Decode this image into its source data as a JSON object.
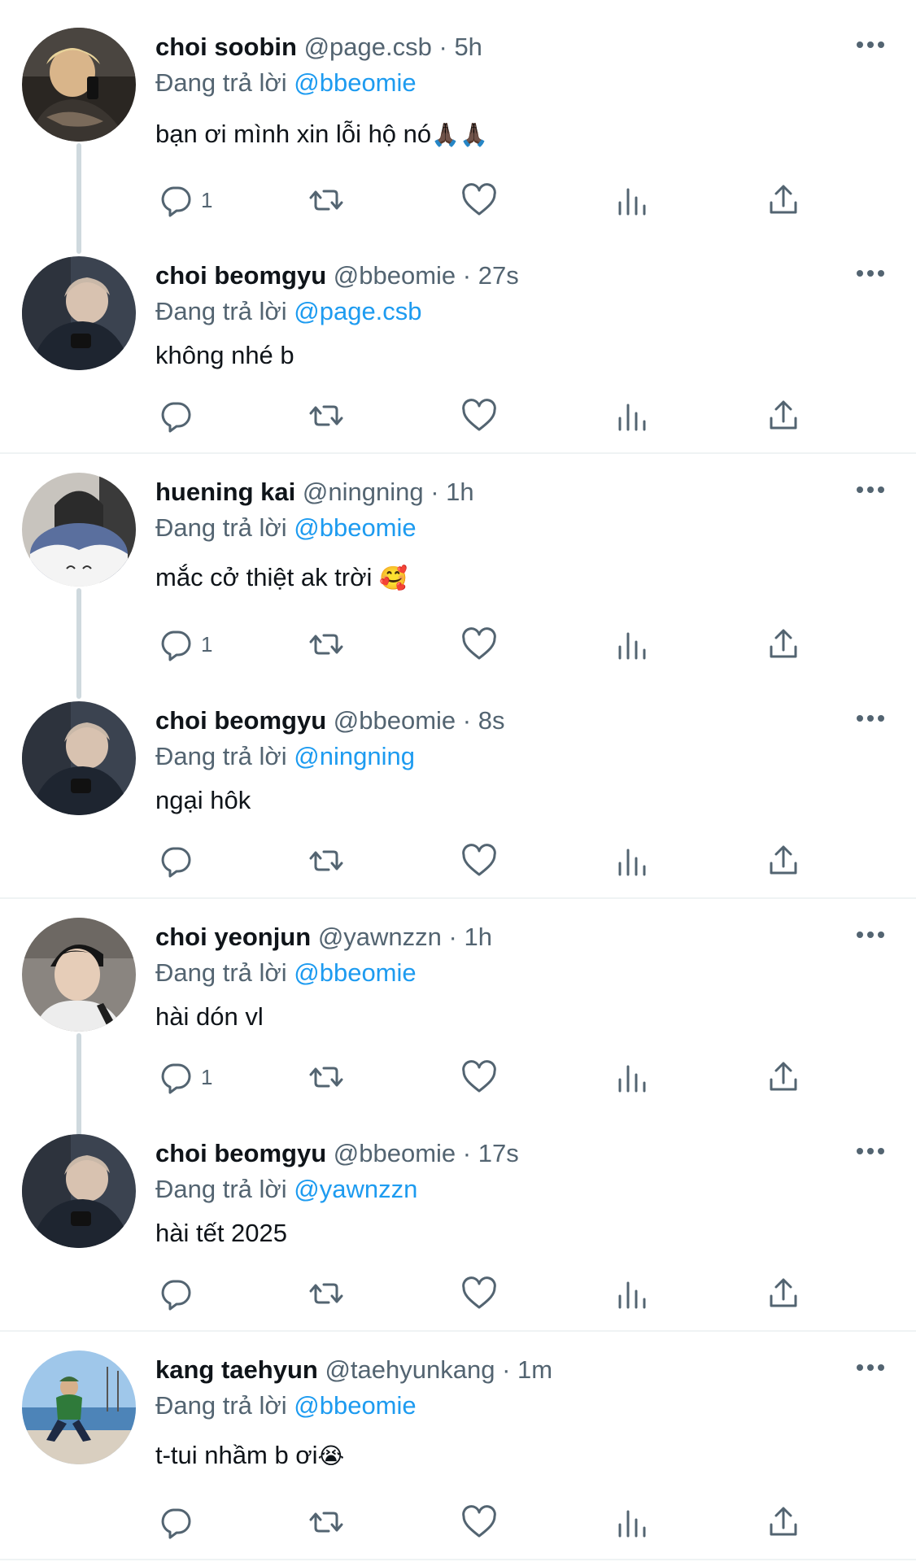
{
  "reply_prefix": "Đang trả lời",
  "dot": "·",
  "colors": {
    "text": "#0f1419",
    "secondary": "#536471",
    "mention": "#1d9bf0",
    "thread_line": "#cfd9de",
    "divider": "#eff3f4"
  },
  "tweets": [
    {
      "name": "choi soobin",
      "handle": "@page.csb",
      "time": "5h",
      "reply_to": "@bbeomie",
      "text": "bạn ơi mình xin lỗi hộ nó",
      "text_emoji": "🙏🏿🙏🏿",
      "reply_count": "1",
      "avatar_icon": "avatar-photo-mirror-selfie"
    },
    {
      "name": "choi beomgyu",
      "handle": "@bbeomie",
      "time": "27s",
      "reply_to": "@page.csb",
      "text": "không nhé b",
      "text_emoji": "",
      "reply_count": "",
      "avatar_icon": "avatar-photo-car-selfie"
    },
    {
      "name": "huening kai",
      "handle": "@ningning",
      "time": "1h",
      "reply_to": "@bbeomie",
      "text": "mắc cở thiệt ak trời",
      "text_emoji": "🥰",
      "reply_count": "1",
      "avatar_icon": "avatar-photo-plush-cover"
    },
    {
      "name": "choi beomgyu",
      "handle": "@bbeomie",
      "time": "8s",
      "reply_to": "@ningning",
      "text": "ngại hôk",
      "text_emoji": "",
      "reply_count": "",
      "avatar_icon": "avatar-photo-car-selfie"
    },
    {
      "name": "choi yeonjun",
      "handle": "@yawnzzn",
      "time": "1h",
      "reply_to": "@bbeomie",
      "text": "hài dón vl",
      "text_emoji": "",
      "reply_count": "1",
      "avatar_icon": "avatar-photo-portrait"
    },
    {
      "name": "choi beomgyu",
      "handle": "@bbeomie",
      "time": "17s",
      "reply_to": "@yawnzzn",
      "text": "hài tết 2025",
      "text_emoji": "",
      "reply_count": "",
      "avatar_icon": "avatar-photo-car-selfie"
    },
    {
      "name": "kang taehyun",
      "handle": "@taehyunkang",
      "time": "1m",
      "reply_to": "@bbeomie",
      "text": "t-tui nhầm b ơi",
      "text_emoji": "😭",
      "reply_count": "",
      "avatar_icon": "avatar-photo-seaside"
    }
  ],
  "action_icons": [
    "reply-icon",
    "retweet-icon",
    "like-icon",
    "views-icon",
    "share-icon"
  ]
}
